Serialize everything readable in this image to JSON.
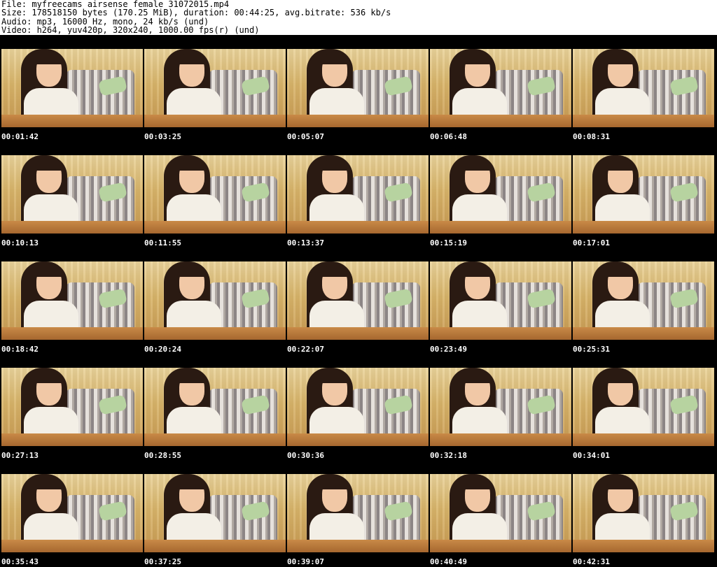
{
  "header": {
    "lines": [
      "File: myfreecams_airsense_female_31072015.mp4",
      "Size: 178518150 bytes (170.25 MiB), duration: 00:44:25, avg.bitrate: 536 kb/s",
      "Audio: mp3, 16000 Hz, mono, 24 kb/s (und)",
      "Video: h264, yuv420p, 320x240, 1000.00 fps(r) (und)"
    ]
  },
  "thumbnails": [
    "00:01:42",
    "00:03:25",
    "00:05:07",
    "00:06:48",
    "00:08:31",
    "00:10:13",
    "00:11:55",
    "00:13:37",
    "00:15:19",
    "00:17:01",
    "00:18:42",
    "00:20:24",
    "00:22:07",
    "00:23:49",
    "00:25:31",
    "00:27:13",
    "00:28:55",
    "00:30:36",
    "00:32:18",
    "00:34:01",
    "00:35:43",
    "00:37:25",
    "00:39:07",
    "00:40:49",
    "00:42:31"
  ],
  "colors": {
    "background": "#000000",
    "header_background": "#ffffff",
    "timestamp_text": "#ffffff"
  }
}
